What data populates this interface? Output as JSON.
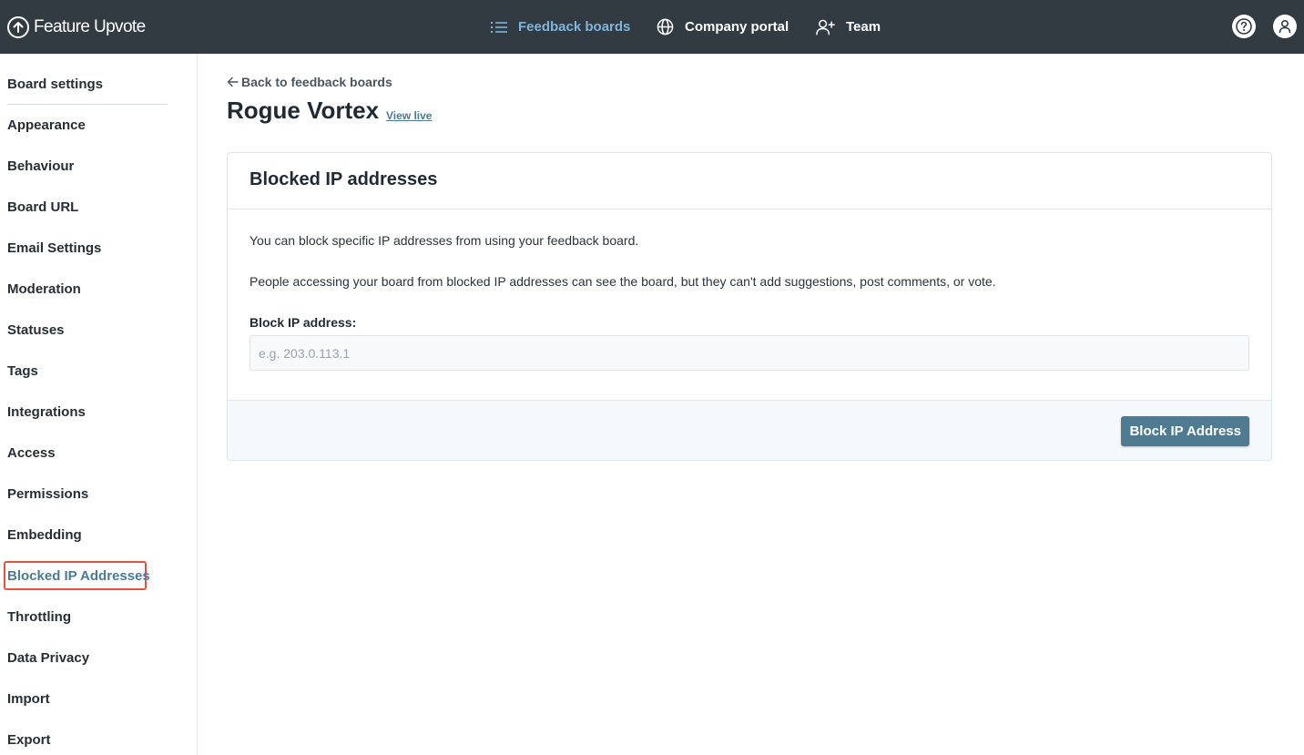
{
  "brand": {
    "name": "Feature Upvote"
  },
  "topnav": {
    "items": [
      {
        "label": "Feedback boards",
        "icon": "list-icon",
        "active": true
      },
      {
        "label": "Company portal",
        "icon": "globe-icon",
        "active": false
      },
      {
        "label": "Team",
        "icon": "add-user-icon",
        "active": false
      }
    ],
    "help_icon": "help-icon",
    "user_icon": "user-icon"
  },
  "sidebar": {
    "items": [
      {
        "label": "Board settings"
      },
      {
        "label": "Appearance"
      },
      {
        "label": "Behaviour"
      },
      {
        "label": "Board URL"
      },
      {
        "label": "Email Settings"
      },
      {
        "label": "Moderation"
      },
      {
        "label": "Statuses"
      },
      {
        "label": "Tags"
      },
      {
        "label": "Integrations"
      },
      {
        "label": "Access"
      },
      {
        "label": "Permissions"
      },
      {
        "label": "Embedding"
      },
      {
        "label": "Blocked IP Addresses",
        "active": true
      },
      {
        "label": "Throttling"
      },
      {
        "label": "Data Privacy"
      },
      {
        "label": "Import"
      },
      {
        "label": "Export"
      }
    ]
  },
  "main": {
    "back_label": "Back to feedback boards",
    "board_title": "Rogue Vortex",
    "view_live_label": "View live",
    "panel": {
      "title": "Blocked IP addresses",
      "description_1": "You can block specific IP addresses from using your feedback board.",
      "description_2": "People accessing your board from blocked IP addresses can see the board, but they can't add suggestions, post comments, or vote.",
      "field_label": "Block IP address:",
      "input_value": "",
      "input_placeholder": "e.g. 203.0.113.1",
      "submit_label": "Block IP Address"
    }
  },
  "colors": {
    "topbar": "#333b42",
    "nav_active": "#7fb4dc",
    "accent": "#4f7b91",
    "active_outline": "#e5533d"
  }
}
